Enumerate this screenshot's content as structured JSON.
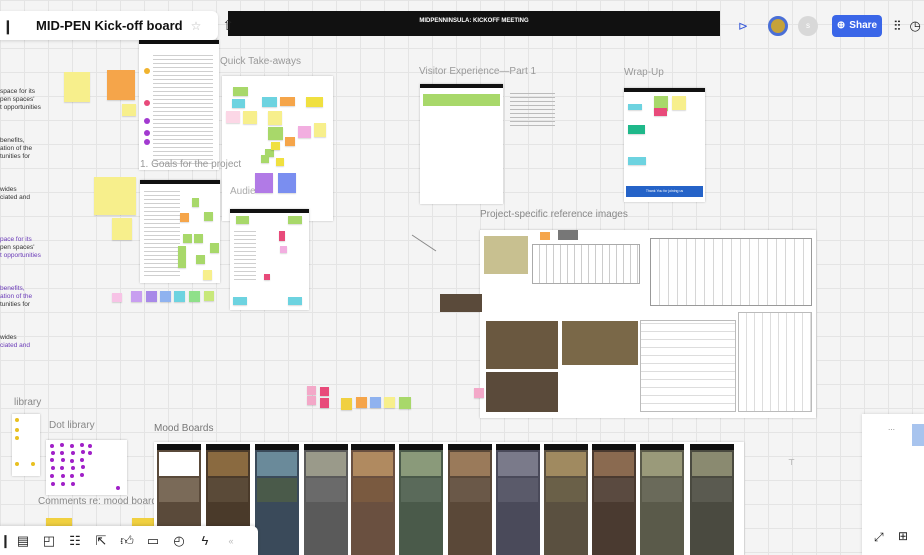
{
  "board": {
    "title": "MID-PEN Kick-off board",
    "banner": "MIDPENNINSULA: KICKOFF MEETING"
  },
  "header": {
    "share_label": "Share",
    "avatar2_initial": "s"
  },
  "sections": {
    "quick_takeaways": "Quick Take-aways",
    "goals": "1. Goals for the project",
    "audience": "Audie",
    "visitor": "Visitor Experience—Part 1",
    "wrapup": "Wrap-Up",
    "refimages": "Project-specific reference images",
    "library": "library",
    "dotlibrary": "Dot library",
    "moodboards": "Mood Boards",
    "comments": "Comments re: mood boards"
  },
  "side_notes": [
    {
      "text": "space for its",
      "color": "#333"
    },
    {
      "text": "pen spaces'",
      "color": "#333"
    },
    {
      "text": "t opportunities",
      "color": "#333"
    },
    {
      "text": "benefits,",
      "color": "#333"
    },
    {
      "text": "ation of the",
      "color": "#333"
    },
    {
      "text": "tunities for",
      "color": "#333"
    },
    {
      "text": "wides",
      "color": "#333"
    },
    {
      "text": "ciated and",
      "color": "#333"
    },
    {
      "text": "pace for its",
      "color": "#6a3ab8"
    },
    {
      "text": "pen spaces'",
      "color": "#333"
    },
    {
      "text": "t opportunities",
      "color": "#6a3ab8"
    },
    {
      "text": "benefits,",
      "color": "#6a3ab8"
    },
    {
      "text": "ation of the",
      "color": "#6a3ab8"
    },
    {
      "text": "tunities for",
      "color": "#333"
    },
    {
      "text": "wides",
      "color": "#333"
    },
    {
      "text": "ciated and",
      "color": "#6a3ab8"
    }
  ],
  "wrapup_button": "Thank You for joining us"
}
